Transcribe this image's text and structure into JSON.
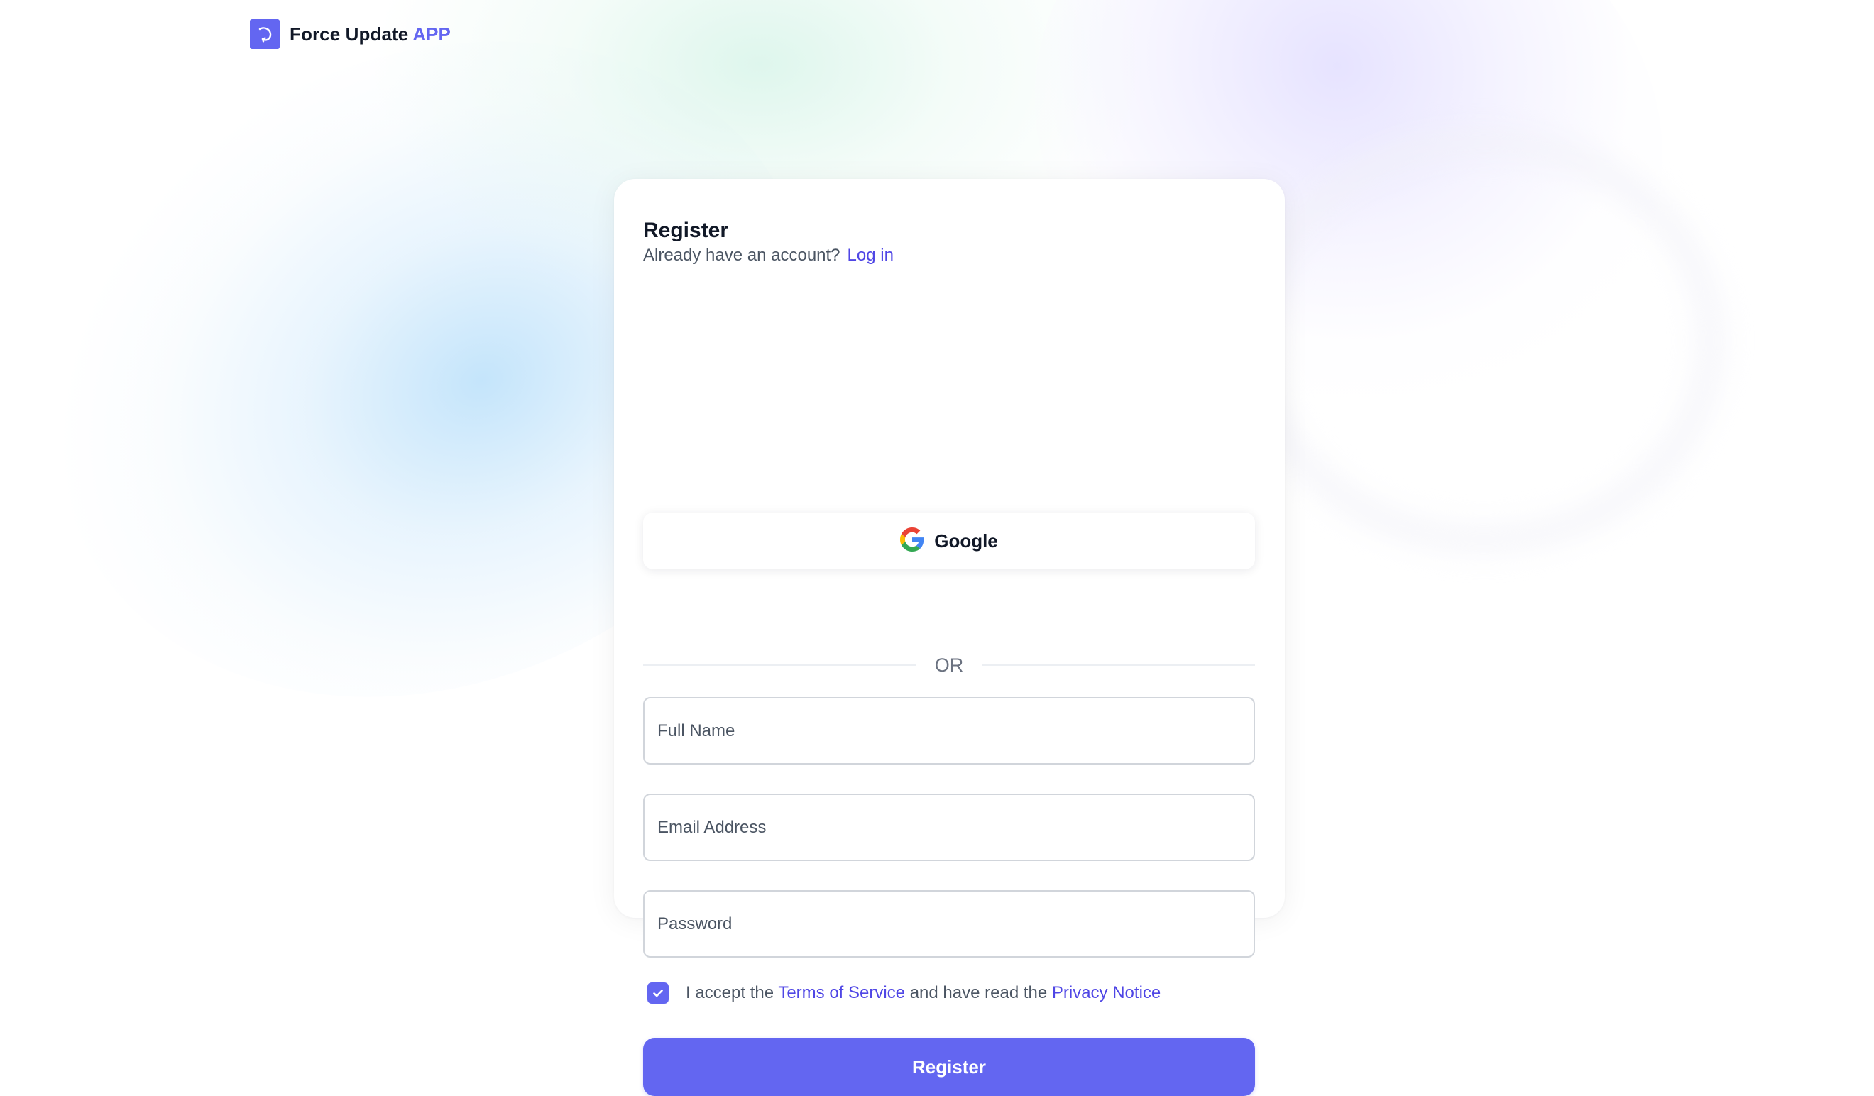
{
  "brand": {
    "name": "Force Update",
    "accent": "APP",
    "logo_icon": "refresh-arc-icon",
    "accent_color": "#6366f1"
  },
  "register_card": {
    "title": "Register",
    "login_prompt": "Already have an account?",
    "login_link": "Log in",
    "google_button": {
      "label": "Google",
      "icon": "google-icon"
    },
    "divider_text": "OR",
    "fields": {
      "full_name_placeholder": "Full Name",
      "email_placeholder": "Email Address",
      "password_placeholder": "Password"
    },
    "terms": {
      "checked": true,
      "prefix": "I accept the",
      "terms_link": "Terms of Service",
      "middle": "and have read the",
      "privacy_link": "Privacy Notice"
    },
    "submit_label": "Register"
  },
  "colors": {
    "primary": "#6366f1",
    "link": "#4f46e5",
    "text": "#111827",
    "muted": "#4b5563"
  }
}
